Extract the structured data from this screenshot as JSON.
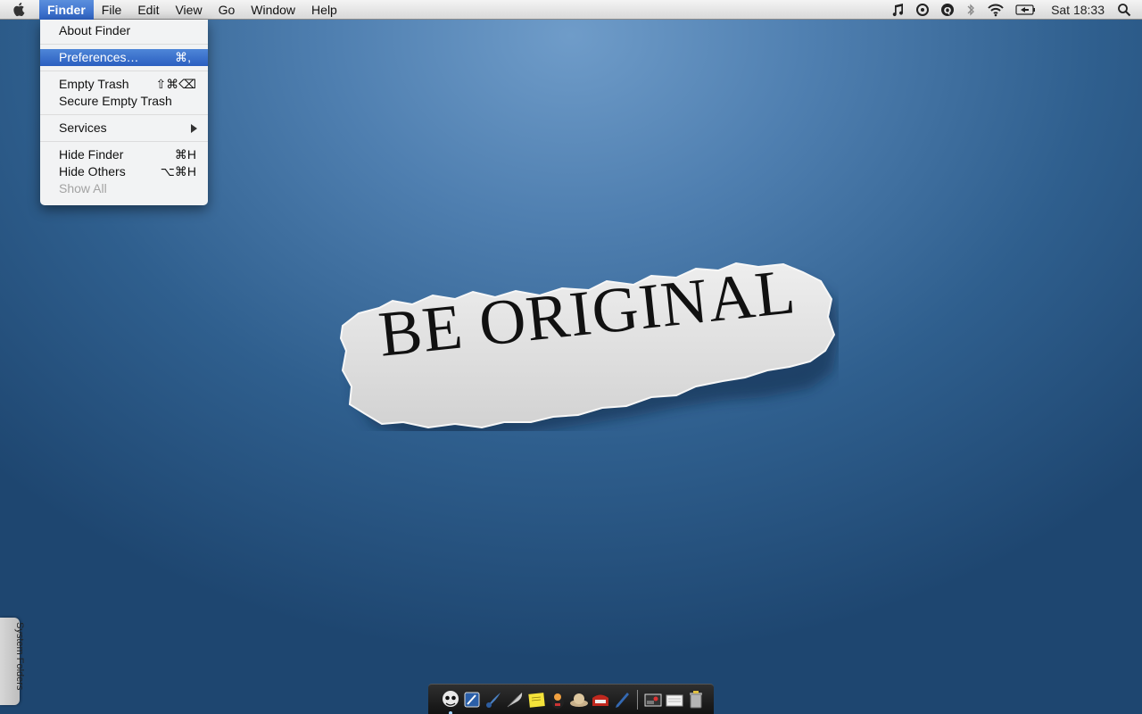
{
  "menubar": {
    "app_name": "Finder",
    "menus": [
      "File",
      "Edit",
      "View",
      "Go",
      "Window",
      "Help"
    ],
    "status_icons": [
      "itunes-icon",
      "growl-icon",
      "q-icon",
      "bluetooth-icon",
      "wifi-icon",
      "battery-icon"
    ],
    "clock": "Sat 18:33"
  },
  "finder_menu": {
    "about": "About Finder",
    "preferences": "Preferences…",
    "preferences_shortcut": "⌘,",
    "empty_trash": "Empty Trash",
    "empty_trash_shortcut": "⇧⌘⌫",
    "secure_empty_trash": "Secure Empty Trash",
    "services": "Services",
    "hide_finder": "Hide Finder",
    "hide_finder_shortcut": "⌘H",
    "hide_others": "Hide Others",
    "hide_others_shortcut": "⌥⌘H",
    "show_all": "Show All"
  },
  "wallpaper": {
    "text": "BE ORIGINAL"
  },
  "side_tab": {
    "label": "System Folders"
  },
  "colors": {
    "menu_highlight": "#2f64c6",
    "desktop": "#2f5f8e"
  }
}
